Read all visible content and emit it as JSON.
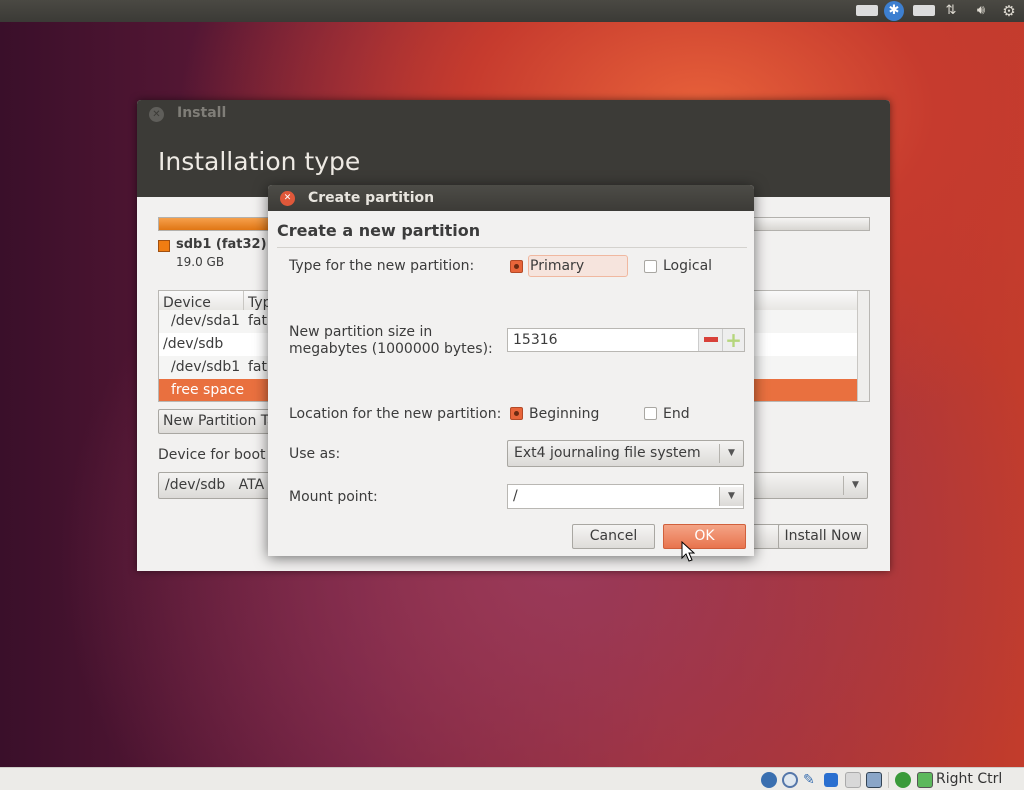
{
  "top_panel": {
    "icons": [
      "keyboard-icon",
      "accessibility-icon",
      "keyboard-layout-icon",
      "network-icon",
      "volume-icon",
      "power-gear-icon"
    ]
  },
  "install_window": {
    "title": "Install",
    "heading": "Installation type",
    "partition_legend": {
      "name": "sdb1 (fat32)",
      "size": "19.0 GB",
      "color": "#f07d12"
    },
    "table": {
      "headers": [
        "Device",
        "Typ"
      ],
      "rows": [
        {
          "device": "/dev/sda1",
          "type": "fat"
        },
        {
          "device": "/dev/sdb",
          "type": ""
        },
        {
          "device": "/dev/sdb1",
          "type": "fat"
        },
        {
          "device": "free space",
          "type": "",
          "selected": true
        }
      ]
    },
    "new_partition_table_button": "New Partition Ta",
    "boot_loader_label": "Device for boot l",
    "boot_loader_value": "/dev/sdb   ATA",
    "install_now_button": "Install Now"
  },
  "dialog": {
    "title": "Create partition",
    "heading": "Create a new partition",
    "type_label": "Type for the new partition:",
    "type_options": [
      {
        "label": "Primary",
        "checked": true
      },
      {
        "label": "Logical",
        "checked": false
      }
    ],
    "size_label_1": "New partition size in",
    "size_label_2": "megabytes (1000000 bytes):",
    "size_value": "15316",
    "location_label": "Location for the new partition:",
    "location_options": [
      {
        "label": "Beginning",
        "checked": true
      },
      {
        "label": "End",
        "checked": false
      }
    ],
    "use_as_label": "Use as:",
    "use_as_value": "Ext4 journaling file system",
    "mount_label": "Mount point:",
    "mount_value": "/",
    "cancel_button": "Cancel",
    "ok_button": "OK",
    "accent": "#e8653a"
  },
  "status_bar": {
    "host_key": "Right Ctrl",
    "icons": [
      "hard-disk-icon",
      "optical-disk-icon",
      "usb-icon",
      "network-adapters-icon",
      "shared-folder-icon",
      "virtualization-icon",
      "mouse-integration-icon",
      "host-key-icon"
    ]
  }
}
